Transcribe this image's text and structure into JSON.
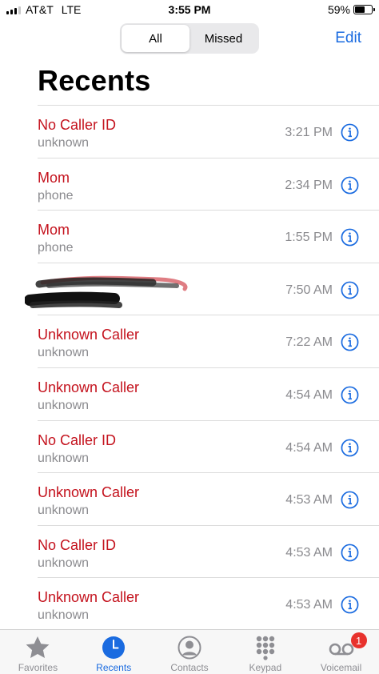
{
  "status_bar": {
    "carrier": "AT&T",
    "network": "LTE",
    "time": "3:55 PM",
    "battery_percent": "59%",
    "battery_level": 0.59
  },
  "segmented": {
    "all_label": "All",
    "missed_label": "Missed",
    "selected": "All"
  },
  "header": {
    "edit_label": "Edit",
    "title": "Recents"
  },
  "calls": [
    {
      "name": "No Caller ID",
      "type": "unknown",
      "time": "3:21 PM"
    },
    {
      "name": "Mom",
      "type": "phone",
      "time": "2:34 PM"
    },
    {
      "name": "Mom",
      "type": "phone",
      "time": "1:55 PM"
    },
    {
      "name": "",
      "type": "",
      "time": "7:50 AM",
      "redacted": true
    },
    {
      "name": "Unknown Caller",
      "type": "unknown",
      "time": "7:22 AM"
    },
    {
      "name": "Unknown Caller",
      "type": "unknown",
      "time": "4:54 AM"
    },
    {
      "name": "No Caller ID",
      "type": "unknown",
      "time": "4:54 AM"
    },
    {
      "name": "Unknown Caller",
      "type": "unknown",
      "time": "4:53 AM"
    },
    {
      "name": "No Caller ID",
      "type": "unknown",
      "time": "4:53 AM"
    },
    {
      "name": "Unknown Caller",
      "type": "unknown",
      "time": "4:53 AM"
    }
  ],
  "tabs": [
    {
      "label": "Favorites",
      "icon": "star-icon",
      "active": false
    },
    {
      "label": "Recents",
      "icon": "clock-icon",
      "active": true
    },
    {
      "label": "Contacts",
      "icon": "person-circle-icon",
      "active": false
    },
    {
      "label": "Keypad",
      "icon": "keypad-icon",
      "active": false
    },
    {
      "label": "Voicemail",
      "icon": "voicemail-icon",
      "active": false,
      "badge": "1"
    }
  ],
  "colors": {
    "accent": "#1a6be0",
    "missed_call": "#c4121d",
    "secondary_text": "#8a8a8e",
    "badge": "#e8322d"
  }
}
